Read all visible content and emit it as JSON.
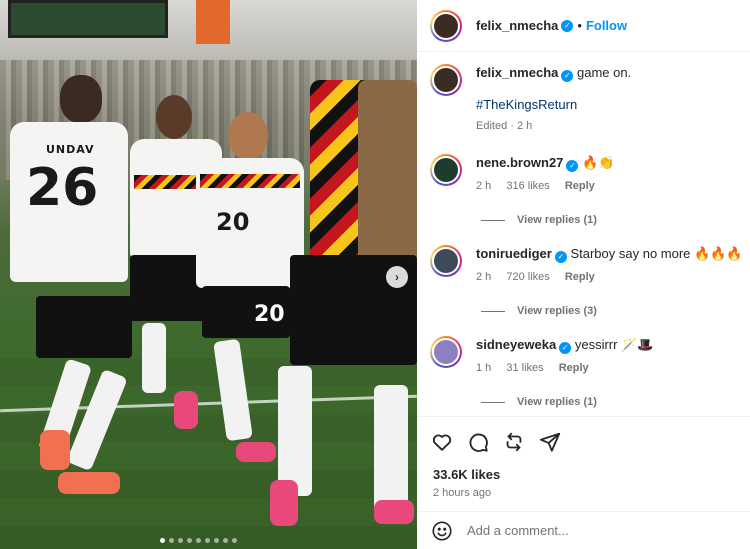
{
  "post": {
    "author": "felix_nmecha",
    "follow_label": "Follow",
    "separator": "•",
    "caption": "game on.",
    "hashtag": "#TheKingsReturn",
    "caption_meta": "Edited · 2 h"
  },
  "photo": {
    "jersey_numbers": [
      "26",
      "20",
      "20"
    ],
    "name_on_back": "UNDAV",
    "carousel": {
      "count": 9,
      "active_index": 0
    }
  },
  "comments": [
    {
      "user": "nene.brown27",
      "text": "🔥👏",
      "time": "2 h",
      "likes": "316 likes",
      "reply": "Reply",
      "view_replies": "View replies (1)"
    },
    {
      "user": "toniruediger",
      "text": "Starboy say no more 🔥🔥🔥",
      "time": "2 h",
      "likes": "720 likes",
      "reply": "Reply",
      "view_replies": "View replies (3)"
    },
    {
      "user": "sidneyeweka",
      "text": "yessirrr 🪄🎩",
      "time": "1 h",
      "likes": "31 likes",
      "reply": "Reply",
      "view_replies": "View replies (1)"
    }
  ],
  "actions": {
    "like_icon": "heart-icon",
    "comment_icon": "comment-icon",
    "share_icon": "repost-icon",
    "send_icon": "send-icon"
  },
  "stats": {
    "likes": "33.6K likes",
    "time": "2 hours ago"
  },
  "add_comment": {
    "placeholder": "Add a comment...",
    "emoji_icon": "emoji-icon"
  },
  "colors": {
    "link": "#0095f6",
    "hashtag": "#00376b",
    "muted": "#737373"
  }
}
